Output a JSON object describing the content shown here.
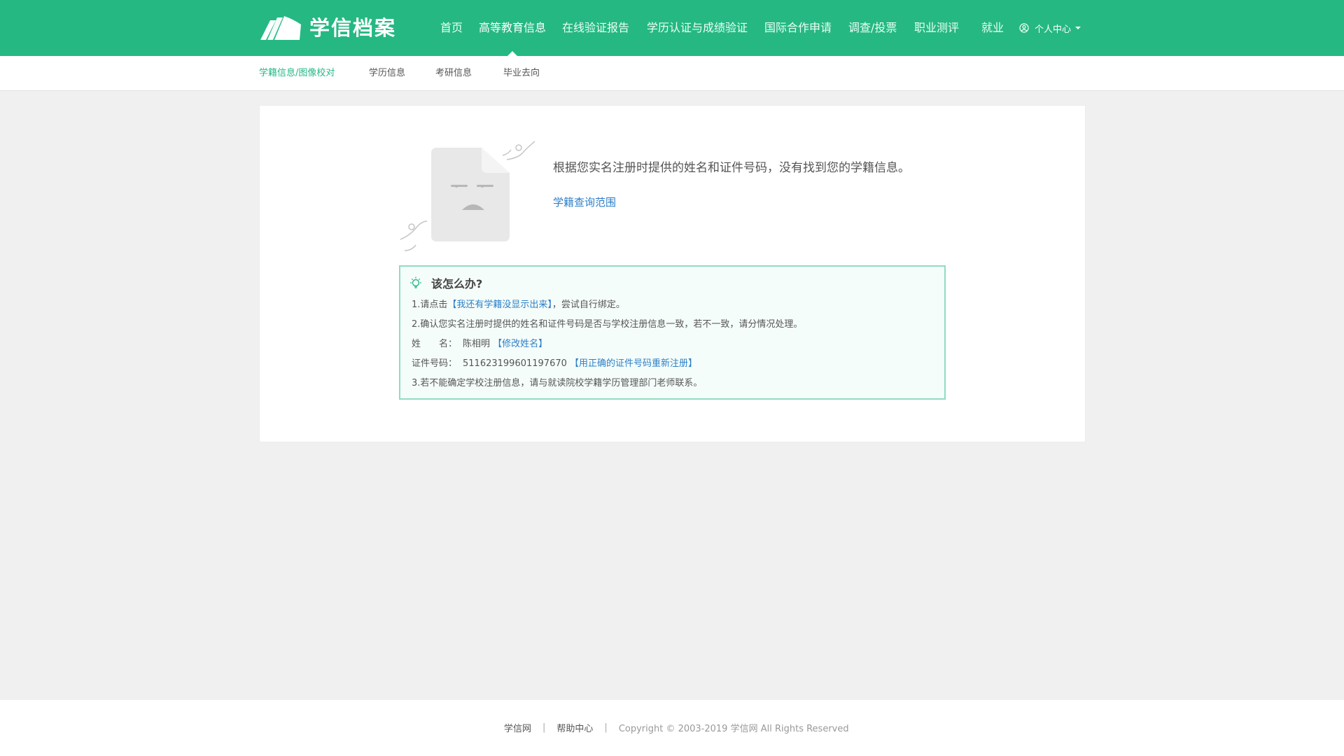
{
  "header": {
    "logo_text": "学信档案",
    "nav": [
      {
        "label": "首页"
      },
      {
        "label": "高等教育信息"
      },
      {
        "label": "在线验证报告"
      },
      {
        "label": "学历认证与成绩验证"
      },
      {
        "label": "国际合作申请"
      },
      {
        "label": "调查/投票"
      },
      {
        "label": "职业测评"
      },
      {
        "label": "就业"
      }
    ],
    "user_menu_label": "个人中心"
  },
  "subnav": {
    "items": [
      {
        "label": "学籍信息/图像校对"
      },
      {
        "label": "学历信息"
      },
      {
        "label": "考研信息"
      },
      {
        "label": "毕业去向"
      }
    ]
  },
  "main": {
    "message": "根据您实名注册时提供的姓名和证件号码，没有找到您的学籍信息。",
    "scope_link": "学籍查询范围",
    "tips": {
      "title": "该怎么办?",
      "line1_prefix": "1.请点击",
      "line1_link": "【我还有学籍没显示出来】",
      "line1_suffix": "，尝试自行绑定。",
      "line2": "2.确认您实名注册时提供的姓名和证件号码是否与学校注册信息一致，若不一致，请分情况处理。",
      "name_label": "姓　　名：",
      "name_value": "陈相明",
      "name_link": "【修改姓名】",
      "id_label": "证件号码：",
      "id_value": "511623199601197670",
      "id_link": "【用正确的证件号码重新注册】",
      "line3": "3.若不能确定学校注册信息，请与就读院校学籍学历管理部门老师联系。"
    }
  },
  "footer": {
    "link1": "学信网",
    "link2": "帮助中心",
    "sep": "|",
    "copyright": "Copyright © 2003-2019 学信网 All Rights Reserved"
  },
  "colors": {
    "brand_green": "#25b883",
    "link_blue": "#2d7fc8",
    "tips_border": "#8fdcbf"
  },
  "icons": {
    "logo": "book-sails-logo-icon",
    "user": "user-circle-icon",
    "dropdown": "caret-down-icon",
    "tips": "lightbulb-icon",
    "illustration": "sad-document-illustration"
  }
}
